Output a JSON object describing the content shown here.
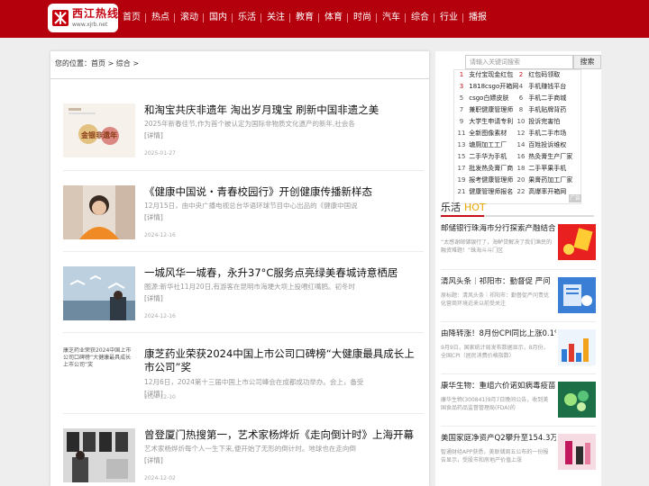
{
  "header": {
    "logo_name": "西江热线",
    "logo_url": "www.xjrb.net",
    "nav": [
      "首页",
      "热点",
      "滚动",
      "国内",
      "乐活",
      "关注",
      "教育",
      "体育",
      "时尚",
      "汽车",
      "综合",
      "行业",
      "播报"
    ]
  },
  "breadcrumb": {
    "prefix": "您的位置：",
    "home": "首页",
    "sep1": " > ",
    "current": "综合",
    "sep2": " >"
  },
  "articles": [
    {
      "title": "和淘宝共庆非遗年 淘出岁月瑰宝 刷新中国非遗之美",
      "desc": "2025年新春佳节,作为首个被认定为国际非物质文化遗产的新年,社会各",
      "more": "[详情]",
      "date": "2025-01-27",
      "thumb_text": "金银非遗年"
    },
    {
      "title": "《健康中国说・青春校园行》开创健康传播新样态",
      "desc": "12月15日，由中央广播电视总台华语环球节目中心出品的《健康中国说",
      "more": "[详情]",
      "date": "2024-12-16"
    },
    {
      "title": "一城风华一城春，永升37°C服务点亮绿美春城诗意栖居",
      "desc": "图源:新华社11月20日,有游客在昆明市海埂大坝上投喂红嘴鸥。初冬时",
      "more": "[详情]",
      "date": "2024-12-16"
    },
    {
      "title": "康芝药业荣获2024中国上市公司口碑榜“大健康最具成长上市公司”奖",
      "desc": "12月6日，2024第十三届中国上市公司峰会在成都成功举办。会上，备受",
      "more": "[详情]",
      "date": "2024-12-10",
      "thumb_alt": "康芝药业荣获2024中国上市公司口碑榜“大健康最具成长上市公司”奖"
    },
    {
      "title": "曾登厦门热搜第一，艺术家杨烨炘《走向倒计时》上海开幕",
      "desc": "艺术家杨烨炘每个人一生下来,便开始了无形的倒计时。地球也在走向倒",
      "more": "[详情]",
      "date": "2024-12-02"
    }
  ],
  "search": {
    "placeholder": "请输入关键词搜索",
    "button": "搜索"
  },
  "ranking": [
    {
      "n": "1",
      "text": "支付宝现金红包"
    },
    {
      "n": "2",
      "text": "红包码领取"
    },
    {
      "n": "3",
      "text": "1818csgo开箱网"
    },
    {
      "n": "4",
      "text": "手机赚钱平台"
    },
    {
      "n": "5",
      "text": "csgo白嫖皮肤"
    },
    {
      "n": "6",
      "text": "手机二手商城"
    },
    {
      "n": "7",
      "text": "兼职健康管理师"
    },
    {
      "n": "8",
      "text": "手机贴牌背药"
    },
    {
      "n": "9",
      "text": "大学生申请专利"
    },
    {
      "n": "10",
      "text": "投诉完害怕"
    },
    {
      "n": "11",
      "text": "全新图像素材"
    },
    {
      "n": "12",
      "text": "手机二手市场"
    },
    {
      "n": "13",
      "text": "塘厕加工工厂"
    },
    {
      "n": "14",
      "text": "百姓投诉维权"
    },
    {
      "n": "15",
      "text": "二手华为手机"
    },
    {
      "n": "16",
      "text": "热灸膏生产厂家"
    },
    {
      "n": "17",
      "text": "批发热灸膏厂商"
    },
    {
      "n": "18",
      "text": "二手苹果手机"
    },
    {
      "n": "19",
      "text": "报考健康管理师"
    },
    {
      "n": "20",
      "text": "果膏药加工厂家"
    },
    {
      "n": "21",
      "text": "健康管理师报名"
    },
    {
      "n": "22",
      "text": "高爆率开箱网"
    }
  ],
  "ranking_close": "广告",
  "side_section": {
    "title": "乐活",
    "hot": "HOT"
  },
  "side_items": [
    {
      "title": "邮储银行珠海市分行探索产融结合",
      "desc": "“太感谢邮储银行了，海鲈贷解决了我们渔民的融资难题！”珠海斗斗门区"
    },
    {
      "title": "清风头条｜祁阳市：勤督促 严问",
      "desc": "原标题：清风头条｜祁阳市：勤督促严问责优化营商环境近来以前受关注"
    },
    {
      "title": "由降转涨！8月份CPI同比上涨0.1%",
      "desc": "9月9日，国家统计局发布数据显示，8月份，全国CPI（居民消费价格指数）"
    },
    {
      "title": "康华生物：重组六价诺如病毒疫苗",
      "desc": "康华生物(300841)9月7日晚间公告，收到美国食品药品监督管理局(FDA)的"
    },
    {
      "title": "美国家庭净资产Q2攀升至154.3万",
      "desc": "智通财经APP获悉，美联储周五公布的一份报告显示，受股市和房地产价值上涨"
    }
  ]
}
